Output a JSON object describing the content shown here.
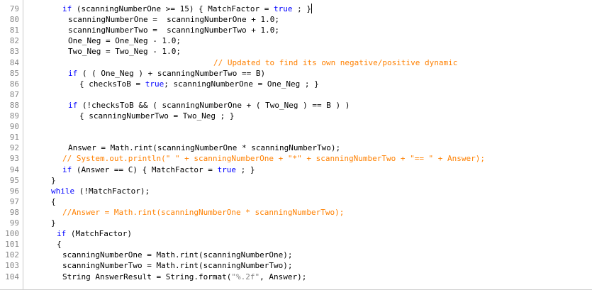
{
  "editor": {
    "lines": [
      {
        "n": "79",
        "indent": 46,
        "segs": [
          [
            "kw",
            "if"
          ],
          [
            "n",
            " (scanningNumberOne >= 15) { MatchFactor = "
          ],
          [
            "kw",
            "true"
          ],
          [
            "n",
            " ; }"
          ]
        ],
        "caret": true
      },
      {
        "n": "80",
        "indent": 54,
        "segs": [
          [
            "n",
            "scanningNumberOne =  scanningNumberOne + 1.0;"
          ]
        ]
      },
      {
        "n": "81",
        "indent": 54,
        "segs": [
          [
            "n",
            "scanningNumberTwo =  scanningNumberTwo + 1.0;"
          ]
        ]
      },
      {
        "n": "82",
        "indent": 54,
        "segs": [
          [
            "n",
            "One_Neg = One_Neg - 1.0;"
          ]
        ]
      },
      {
        "n": "83",
        "indent": 54,
        "segs": [
          [
            "n",
            "Two_Neg = Two_Neg - 1.0;"
          ]
        ]
      },
      {
        "n": "84",
        "indent": 259,
        "segs": [
          [
            "cm",
            "// Updated to find its own negative/positive dynamic"
          ]
        ]
      },
      {
        "n": "85",
        "indent": 54,
        "segs": [
          [
            "kw",
            "if"
          ],
          [
            "n",
            " ( ( One_Neg ) + scanningNumberTwo == B)"
          ]
        ]
      },
      {
        "n": "86",
        "indent": 70,
        "segs": [
          [
            "n",
            "{ checksToB = "
          ],
          [
            "kw",
            "true"
          ],
          [
            "n",
            "; scanningNumberOne = One_Neg ; }"
          ]
        ]
      },
      {
        "n": "87",
        "indent": 54,
        "segs": []
      },
      {
        "n": "88",
        "indent": 54,
        "segs": [
          [
            "kw",
            "if"
          ],
          [
            "n",
            " (!checksToB && ( scanningNumberOne + ( Two_Neg ) == B ) )"
          ]
        ]
      },
      {
        "n": "89",
        "indent": 70,
        "segs": [
          [
            "n",
            "{ scanningNumberTwo = Two_Neg ; }"
          ]
        ]
      },
      {
        "n": "90",
        "indent": 54,
        "segs": []
      },
      {
        "n": "91",
        "indent": 54,
        "segs": []
      },
      {
        "n": "92",
        "indent": 54,
        "segs": [
          [
            "n",
            "Answer = Math.rint(scanningNumberOne * scanningNumberTwo);"
          ]
        ]
      },
      {
        "n": "93",
        "indent": 46,
        "segs": [
          [
            "cm",
            "// System.out.println(\" \" + scanningNumberOne + \"*\" + scanningNumberTwo + \"== \" + Answer);"
          ]
        ]
      },
      {
        "n": "94",
        "indent": 46,
        "segs": [
          [
            "kw",
            "if"
          ],
          [
            "n",
            " (Answer == C) { MatchFactor = "
          ],
          [
            "kw",
            "true"
          ],
          [
            "n",
            " ; }"
          ]
        ]
      },
      {
        "n": "95",
        "indent": 30,
        "segs": [
          [
            "n",
            "}"
          ]
        ]
      },
      {
        "n": "96",
        "indent": 30,
        "segs": [
          [
            "kw",
            "while"
          ],
          [
            "n",
            " (!MatchFactor);"
          ]
        ]
      },
      {
        "n": "97",
        "indent": 30,
        "segs": [
          [
            "n",
            "{"
          ]
        ]
      },
      {
        "n": "98",
        "indent": 46,
        "segs": [
          [
            "cm",
            "//Answer = Math.rint(scanningNumberOne * scanningNumberTwo);"
          ]
        ]
      },
      {
        "n": "99",
        "indent": 30,
        "segs": [
          [
            "n",
            "}"
          ]
        ]
      },
      {
        "n": "100",
        "indent": 38,
        "segs": [
          [
            "kw",
            "if"
          ],
          [
            "n",
            " (MatchFactor)"
          ]
        ]
      },
      {
        "n": "101",
        "indent": 38,
        "segs": [
          [
            "n",
            "{"
          ]
        ]
      },
      {
        "n": "102",
        "indent": 46,
        "segs": [
          [
            "n",
            "scanningNumberOne = Math.rint(scanningNumberOne);"
          ]
        ]
      },
      {
        "n": "103",
        "indent": 46,
        "segs": [
          [
            "n",
            "scanningNumberTwo = Math.rint(scanningNumberTwo);"
          ]
        ]
      },
      {
        "n": "104",
        "indent": 46,
        "segs": [
          [
            "n",
            "String AnswerResult = String.format("
          ],
          [
            "st",
            "\"%.2f\""
          ],
          [
            "n",
            ", Answer);"
          ]
        ]
      }
    ]
  },
  "colors": {
    "keyword": "#0000ff",
    "comment": "#ff8000",
    "string": "#808080",
    "text": "#000000",
    "line_number": "#888888"
  }
}
